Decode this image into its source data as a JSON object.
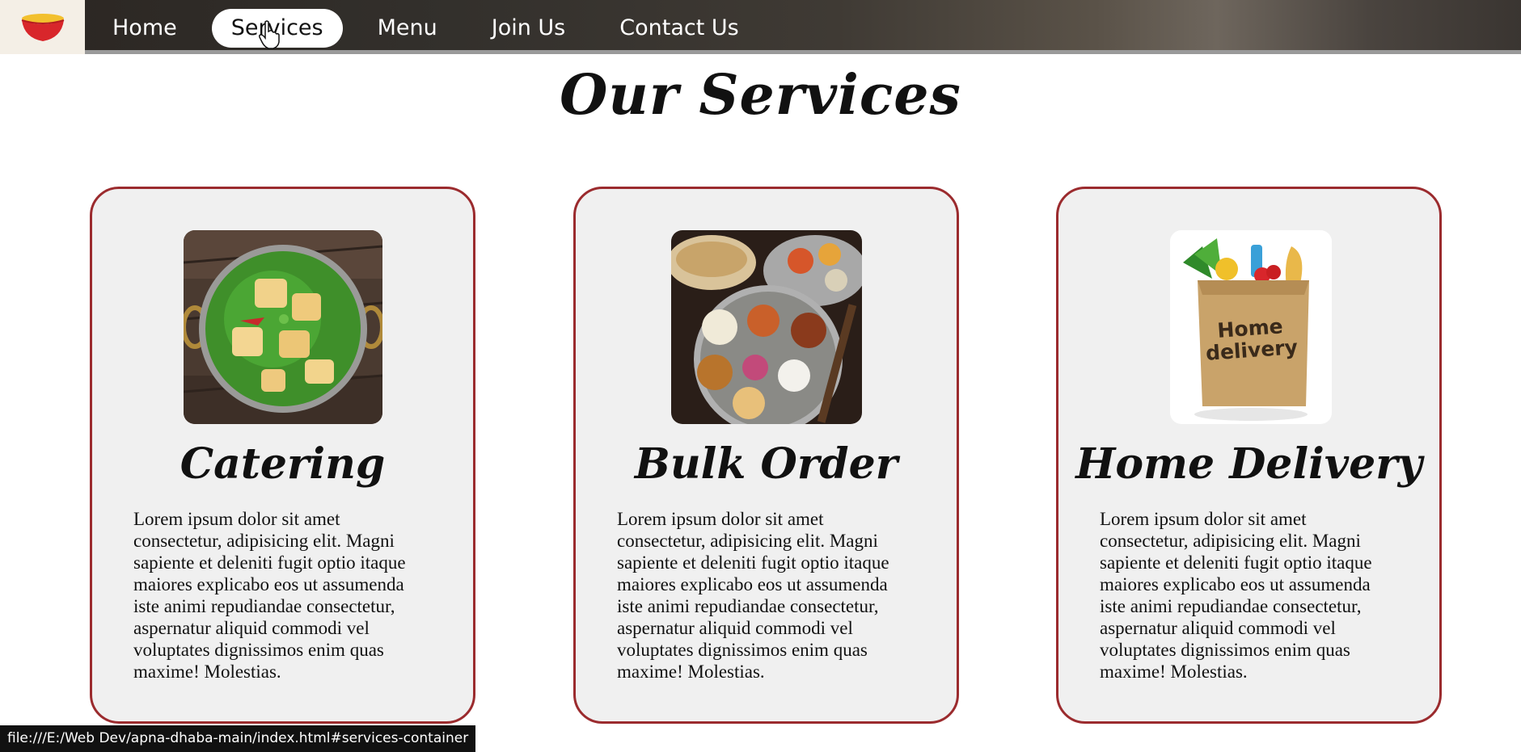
{
  "navbar": {
    "logo_icon": "noodle-bowl-icon",
    "links": [
      {
        "label": "Home",
        "active": false
      },
      {
        "label": "Services",
        "active": true
      },
      {
        "label": "Menu",
        "active": false
      },
      {
        "label": "Join Us",
        "active": false
      },
      {
        "label": "Contact Us",
        "active": false
      }
    ],
    "colors": {
      "active_bg": "#ffffff",
      "text": "#ffffff"
    }
  },
  "page": {
    "title": "Our Services"
  },
  "services": [
    {
      "title": "Catering",
      "image": "palak-paneer-dish",
      "description": "Lorem ipsum dolor sit amet consectetur, adipisicing elit. Magni sapiente et deleniti fugit optio itaque maiores explicabo eos ut assumenda iste animi repudiandae consectetur, aspernatur aliquid commodi vel voluptates dignissimos enim quas maxime! Molestias."
    },
    {
      "title": "Bulk Order",
      "image": "thali-platter",
      "description": "Lorem ipsum dolor sit amet consectetur, adipisicing elit. Magni sapiente et deleniti fugit optio itaque maiores explicabo eos ut assumenda iste animi repudiandae consectetur, aspernatur aliquid commodi vel voluptates dignissimos enim quas maxime! Molestias."
    },
    {
      "title": "Home Delivery",
      "image": "grocery-bag",
      "image_label": "Home delivery",
      "description": "Lorem ipsum dolor sit amet consectetur, adipisicing elit. Magni sapiente et deleniti fugit optio itaque maiores explicabo eos ut assumenda iste animi repudiandae consectetur, aspernatur aliquid commodi vel voluptates dignissimos enim quas maxime! Molestias."
    }
  ],
  "colors": {
    "card_border": "#9b2b2e",
    "card_bg": "#f0f0f0"
  },
  "status_bar": {
    "url": "file:///E:/Web Dev/apna-dhaba-main/index.html#services-container"
  }
}
